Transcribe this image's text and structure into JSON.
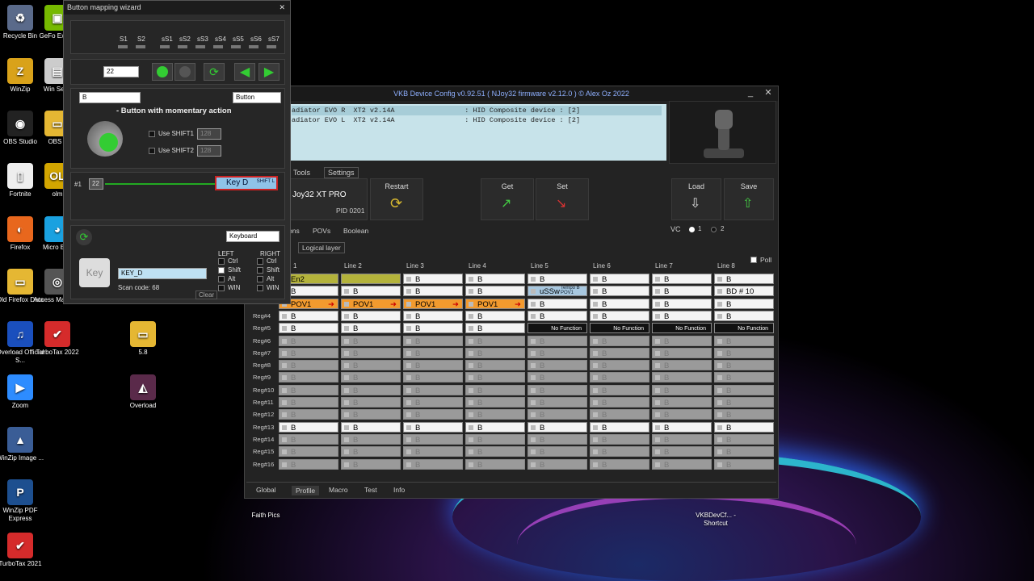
{
  "desktop": {
    "icons": [
      {
        "label": "Recycle Bin",
        "glyph": "♻",
        "color": "#5a6a8a"
      },
      {
        "label": "WinZip",
        "glyph": "Z",
        "color": "#d9a21a"
      },
      {
        "label": "OBS Studio",
        "glyph": "◉",
        "color": "#222"
      },
      {
        "label": "Fortnite",
        "glyph": "▯",
        "color": "#eee"
      },
      {
        "label": "Firefox",
        "glyph": "◐",
        "color": "#e8671d"
      },
      {
        "label": "Old Firefox Data",
        "glyph": "▭",
        "color": "#e5b733"
      },
      {
        "label": "Overload Official S...",
        "glyph": "♫",
        "color": "#1a4fbd"
      },
      {
        "label": "Zoom",
        "glyph": "▶",
        "color": "#2d8cff"
      },
      {
        "label": "WinZip Image ...",
        "glyph": "▲",
        "color": "#3a5d96"
      },
      {
        "label": "WinZip PDF Express",
        "glyph": "P",
        "color": "#1d4f8f"
      },
      {
        "label": "TurboTax 2021",
        "glyph": "✔",
        "color": "#d52b2b"
      }
    ],
    "icons2": [
      {
        "label": "GeFo Experi",
        "glyph": "▣",
        "color": "#76b900"
      },
      {
        "label": "Win Secu",
        "glyph": "▤",
        "color": "#ccc"
      },
      {
        "label": "OBS v",
        "glyph": "▭",
        "color": "#e5b733"
      },
      {
        "label": "olm",
        "glyph": "OL",
        "color": "#d2a500"
      },
      {
        "label": "Micro Edg",
        "glyph": "◕",
        "color": "#1aa1e0"
      },
      {
        "label": "Access Manager",
        "glyph": "◎",
        "color": "#555"
      },
      {
        "label": "TurboTax 2022",
        "glyph": "✔",
        "color": "#d52b2b"
      }
    ],
    "icons3": [
      {
        "label": "5.8",
        "glyph": "▭",
        "color": "#e5b733"
      },
      {
        "label": "Overload",
        "glyph": "◭",
        "color": "#5a2a4a"
      },
      {
        "label": "Faith Pics",
        "glyph": "",
        "color": "transparent"
      },
      {
        "label": "VKBDevCf... - Shortcut",
        "glyph": "",
        "color": "transparent"
      }
    ]
  },
  "vkb": {
    "title": "VKB Device Config v0.92.51 ( NJoy32 firmware v2.12.0 ) © Alex Oz 2022",
    "min": "_",
    "close": "✕",
    "devices": [
      "adiator EVO R  XT2 v2.14A                 : HID Composite device : [2]",
      "adiator EVO L  XT2 v2.14A                 : HID Composite device : [2]"
    ],
    "tabs": [
      "Tools",
      "Settings"
    ],
    "device_name": "Joy32 XT PRO",
    "pid": "PID 0201",
    "restart": "Restart",
    "get": "Get",
    "set": "Set",
    "load": "Load",
    "save": "Save",
    "subtabs": [
      "ons",
      "POVs",
      "Boolean"
    ],
    "vc_label": "VC",
    "vc1": "1",
    "vc2": "2",
    "logical_layer": "Logical layer",
    "poll": "Poll",
    "line_headers": [
      "1",
      "Line 2",
      "Line 3",
      "Line 4",
      "Line 5",
      "Line 6",
      "Line 7",
      "Line 8"
    ],
    "reg_labels": [
      "",
      "",
      "",
      "Reg#4",
      "Reg#5",
      "Reg#6",
      "Reg#7",
      "Reg#8",
      "Reg#9",
      "Reg#10",
      "Reg#11",
      "Reg#12",
      "Reg#13",
      "Reg#14",
      "Reg#15",
      "Reg#16"
    ],
    "rows": [
      [
        [
          "En2",
          "olive"
        ],
        [
          "",
          "olive"
        ],
        [
          "B",
          "white"
        ],
        [
          "B",
          "white"
        ],
        [
          "B",
          "white"
        ],
        [
          "B",
          "white"
        ],
        [
          "B",
          "white"
        ],
        [
          "B",
          "white"
        ]
      ],
      [
        [
          "B",
          "white"
        ],
        [
          "B",
          "white"
        ],
        [
          "B",
          "white"
        ],
        [
          "B",
          "white"
        ],
        [
          "uSSw",
          "blue"
        ],
        [
          "B",
          "white"
        ],
        [
          "B",
          "white"
        ],
        [
          "BD  # 10",
          "white"
        ]
      ],
      [
        [
          "POV1",
          "orange"
        ],
        [
          "POV1",
          "orange"
        ],
        [
          "POV1",
          "orange"
        ],
        [
          "POV1",
          "orange"
        ],
        [
          "B",
          "white"
        ],
        [
          "B",
          "white"
        ],
        [
          "B",
          "white"
        ],
        [
          "B",
          "white"
        ]
      ],
      [
        [
          "B",
          "white"
        ],
        [
          "B",
          "white"
        ],
        [
          "B",
          "white"
        ],
        [
          "B",
          "white"
        ],
        [
          "B",
          "white"
        ],
        [
          "B",
          "white"
        ],
        [
          "B",
          "white"
        ],
        [
          "B",
          "white"
        ]
      ],
      [
        [
          "B",
          "white"
        ],
        [
          "B",
          "white"
        ],
        [
          "B",
          "white"
        ],
        [
          "B",
          "white"
        ],
        [
          "No Function",
          "black"
        ],
        [
          "No Function",
          "black"
        ],
        [
          "No Function",
          "black"
        ],
        [
          "No Function",
          "black"
        ]
      ],
      [
        [
          "B",
          "grey"
        ],
        [
          "B",
          "grey"
        ],
        [
          "B",
          "grey"
        ],
        [
          "B",
          "grey"
        ],
        [
          "B",
          "grey"
        ],
        [
          "B",
          "grey"
        ],
        [
          "B",
          "grey"
        ],
        [
          "B",
          "grey"
        ]
      ],
      [
        [
          "B",
          "grey"
        ],
        [
          "B",
          "grey"
        ],
        [
          "B",
          "grey"
        ],
        [
          "B",
          "grey"
        ],
        [
          "B",
          "grey"
        ],
        [
          "B",
          "grey"
        ],
        [
          "B",
          "grey"
        ],
        [
          "B",
          "grey"
        ]
      ],
      [
        [
          "B",
          "grey"
        ],
        [
          "B",
          "grey"
        ],
        [
          "B",
          "grey"
        ],
        [
          "B",
          "grey"
        ],
        [
          "B",
          "grey"
        ],
        [
          "B",
          "grey"
        ],
        [
          "B",
          "grey"
        ],
        [
          "B",
          "grey"
        ]
      ],
      [
        [
          "B",
          "grey"
        ],
        [
          "B",
          "grey"
        ],
        [
          "B",
          "grey"
        ],
        [
          "B",
          "grey"
        ],
        [
          "B",
          "grey"
        ],
        [
          "B",
          "grey"
        ],
        [
          "B",
          "grey"
        ],
        [
          "B",
          "grey"
        ]
      ],
      [
        [
          "B",
          "grey"
        ],
        [
          "B",
          "grey"
        ],
        [
          "B",
          "grey"
        ],
        [
          "B",
          "grey"
        ],
        [
          "B",
          "grey"
        ],
        [
          "B",
          "grey"
        ],
        [
          "B",
          "grey"
        ],
        [
          "B",
          "grey"
        ]
      ],
      [
        [
          "B",
          "grey"
        ],
        [
          "B",
          "grey"
        ],
        [
          "B",
          "grey"
        ],
        [
          "B",
          "grey"
        ],
        [
          "B",
          "grey"
        ],
        [
          "B",
          "grey"
        ],
        [
          "B",
          "grey"
        ],
        [
          "B",
          "grey"
        ]
      ],
      [
        [
          "B",
          "grey"
        ],
        [
          "B",
          "grey"
        ],
        [
          "B",
          "grey"
        ],
        [
          "B",
          "grey"
        ],
        [
          "B",
          "grey"
        ],
        [
          "B",
          "grey"
        ],
        [
          "B",
          "grey"
        ],
        [
          "B",
          "grey"
        ]
      ],
      [
        [
          "B",
          "white"
        ],
        [
          "B",
          "white"
        ],
        [
          "B",
          "white"
        ],
        [
          "B",
          "white"
        ],
        [
          "B",
          "white"
        ],
        [
          "B",
          "white"
        ],
        [
          "B",
          "white"
        ],
        [
          "B",
          "white"
        ]
      ],
      [
        [
          "B",
          "grey"
        ],
        [
          "B",
          "grey"
        ],
        [
          "B",
          "grey"
        ],
        [
          "B",
          "grey"
        ],
        [
          "B",
          "grey"
        ],
        [
          "B",
          "grey"
        ],
        [
          "B",
          "grey"
        ],
        [
          "B",
          "grey"
        ]
      ],
      [
        [
          "B",
          "grey"
        ],
        [
          "B",
          "grey"
        ],
        [
          "B",
          "grey"
        ],
        [
          "B",
          "grey"
        ],
        [
          "B",
          "grey"
        ],
        [
          "B",
          "grey"
        ],
        [
          "B",
          "grey"
        ],
        [
          "B",
          "grey"
        ]
      ],
      [
        [
          "B",
          "grey"
        ],
        [
          "B",
          "grey"
        ],
        [
          "B",
          "grey"
        ],
        [
          "B",
          "grey"
        ],
        [
          "B",
          "grey"
        ],
        [
          "B",
          "grey"
        ],
        [
          "B",
          "grey"
        ],
        [
          "B",
          "grey"
        ]
      ]
    ],
    "tempo_label": "Tempo B POV1",
    "bottom_tabs": [
      "Global",
      "Profile",
      "Macro",
      "Test",
      "Info"
    ]
  },
  "wizard": {
    "title": "Button mapping wizard",
    "close": "✕",
    "shift_labels": [
      "S1",
      "S2",
      "sS1",
      "sS2",
      "sS3",
      "sS4",
      "sS5",
      "sS6",
      "sS7"
    ],
    "button_number": "22",
    "name_value": "B",
    "type_select": "Button",
    "action_desc": "- Button with momentary action",
    "use_shift1": "Use SHIFT1",
    "use_shift2": "Use SHIFT2",
    "shift_val1": "128",
    "shift_val2": "128",
    "line_no": "#1",
    "line_btn": "22",
    "key_label": "Key D",
    "key_shift": "SHIFT L",
    "kb_select": "Keyboard",
    "key_icon_text": "Key",
    "key_code": "KEY_D",
    "scan_code": "Scan code:  68",
    "clear": "Clear",
    "left": "LEFT",
    "right": "RIGHT",
    "mods": [
      "Ctrl",
      "Shift",
      "Alt",
      "WIN"
    ]
  }
}
